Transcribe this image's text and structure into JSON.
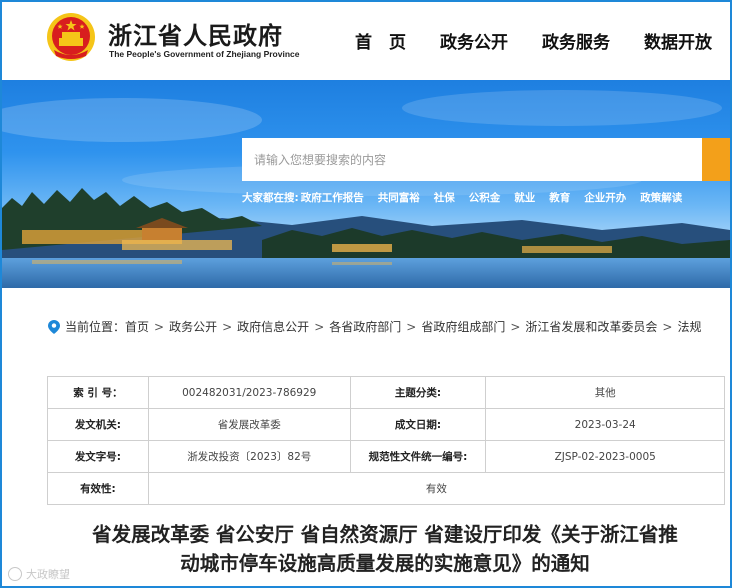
{
  "header": {
    "title": "浙江省人民政府",
    "subtitle": "The People's Government of Zhejiang Province",
    "nav": [
      "首　页",
      "政务公开",
      "政务服务",
      "数据开放"
    ]
  },
  "banner": {
    "search_placeholder": "请输入您想要搜索的内容",
    "hot_label": "大家都在搜:",
    "hot_items": [
      "政府工作报告",
      "共同富裕",
      "社保",
      "公积金",
      "就业",
      "教育",
      "企业开办",
      "政策解读"
    ]
  },
  "breadcrumb": {
    "label": "当前位置：",
    "items": [
      "首页",
      "政务公开",
      "政府信息公开",
      "各省政府部门",
      "省政府组成部门",
      "浙江省发展和改革委员会",
      "法规"
    ]
  },
  "meta": {
    "index_no_label": "索 引 号：",
    "index_no": "002482031/2023-786929",
    "topic_label": "主题分类:",
    "topic": "其他",
    "issuer_label": "发文机关:",
    "issuer": "省发展改革委",
    "date_label": "成文日期:",
    "date": "2023-03-24",
    "doc_no_label": "发文字号:",
    "doc_no": "浙发改投资〔2023〕82号",
    "norm_no_label": "规范性文件统一编号:",
    "norm_no": "ZJSP-02-2023-0005",
    "validity_label": "有效性:",
    "validity": "有效"
  },
  "article": {
    "title_line1": "省发展改革委 省公安厅 省自然资源厅 省建设厅印发《关于浙江省推",
    "title_line2": "动城市停车设施高质量发展的实施意见》的通知"
  },
  "watermark": {
    "text": "大政瞭望"
  },
  "colors": {
    "frame": "#1e88d8",
    "search_button": "#f3a01a",
    "emblem_red": "#d81e1e",
    "emblem_gold": "#f5c518"
  }
}
